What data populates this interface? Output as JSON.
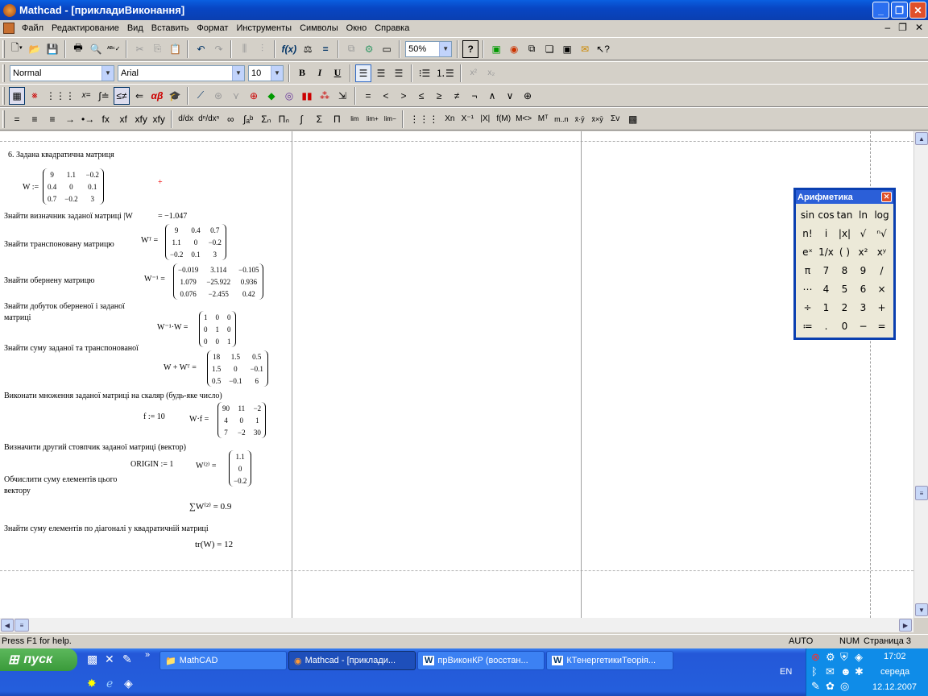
{
  "window": {
    "title": "Mathcad - [прикладиВиконання]"
  },
  "menu": [
    "Файл",
    "Редактирование",
    "Вид",
    "Вставить",
    "Формат",
    "Инструменты",
    "Символы",
    "Окно",
    "Справка"
  ],
  "toolbar": {
    "zoom": "50%"
  },
  "format_bar": {
    "style": "Normal",
    "font": "Arial",
    "size": "10",
    "bold": "B",
    "italic": "I",
    "underline": "U",
    "sup": "x²",
    "sub": "x₂"
  },
  "math_bar": {
    "alpha": "αβ"
  },
  "bool_bar": [
    "=",
    "<",
    ">",
    "≤",
    "≥",
    "≠",
    "¬",
    "∧",
    "∨",
    "⊕"
  ],
  "sym_bar": [
    "=",
    "≡",
    "≡",
    "→",
    "•→",
    "fx",
    "xf",
    "xfy",
    "xfy"
  ],
  "matrix_bar_labels": [
    "Xn",
    "X⁻¹",
    "|X|",
    "M<>",
    "Mᵀ",
    "m..n",
    "x̄·ȳ",
    "x̄×ȳ",
    "Σv"
  ],
  "worksheet": {
    "heading": "6. Задана квадратична матриця",
    "w_label": "W :=",
    "w": [
      [
        "9",
        "1.1",
        "−0.2"
      ],
      [
        "0.4",
        "0",
        "0.1"
      ],
      [
        "0.7",
        "−0.2",
        "3"
      ]
    ],
    "det_text": "Знайти визначник заданої матриці |W",
    "det_value": "= −1.047",
    "trans_text": "Знайти транспоновану матрицю",
    "wt_label": "Wᵀ =",
    "wt": [
      [
        "9",
        "0.4",
        "0.7"
      ],
      [
        "1.1",
        "0",
        "−0.2"
      ],
      [
        "−0.2",
        "0.1",
        "3"
      ]
    ],
    "inv_text": "Знайти обернену матрицю",
    "winv_label": "W⁻¹ =",
    "winv": [
      [
        "−0.019",
        "3.114",
        "−0.105"
      ],
      [
        "1.079",
        "−25.922",
        "0.936"
      ],
      [
        "0.076",
        "−2.455",
        "0.42"
      ]
    ],
    "prod_text1": "Знайти добуток оберненої і заданої",
    "prod_text2": "матриці",
    "prod_label": "W⁻¹·W =",
    "prod": [
      [
        "1",
        "0",
        "0"
      ],
      [
        "0",
        "1",
        "0"
      ],
      [
        "0",
        "0",
        "1"
      ]
    ],
    "sum_text": "Знайти суму заданої та транспонованої",
    "sum_label": "W + Wᵀ =",
    "sum": [
      [
        "18",
        "1.5",
        "0.5"
      ],
      [
        "1.5",
        "0",
        "−0.1"
      ],
      [
        "0.5",
        "−0.1",
        "6"
      ]
    ],
    "scal_text": "Виконати множення заданої матриці на скаляр (будь-яке число)",
    "f_def": "f := 10",
    "wf_label": "W·f =",
    "wf": [
      [
        "90",
        "11",
        "−2"
      ],
      [
        "4",
        "0",
        "1"
      ],
      [
        "7",
        "−2",
        "30"
      ]
    ],
    "col_text": "Визначити другий стовпчик заданої матриці (вектор)",
    "origin": "ORIGIN := 1",
    "col_label": "W⁽²⁾ =",
    "col": [
      [
        "1.1"
      ],
      [
        "0"
      ],
      [
        "−0.2"
      ]
    ],
    "sumel_text1": "Обчислити суму елементів цього",
    "sumel_text2": "вектору",
    "sumel_expr": "∑W⁽²⁾ = 0.9",
    "diag_text": "Знайти суму елементів по діагоналі у квадратичній матриці",
    "tr_expr": "tr(W) = 12"
  },
  "palette": {
    "title": "Арифметика",
    "keys": [
      "sin",
      "cos",
      "tan",
      "ln",
      "log",
      "n!",
      "i",
      "|x|",
      "√",
      "ⁿ√",
      "eˣ",
      "1/x",
      "( )",
      "x²",
      "xʸ",
      "π",
      "7",
      "8",
      "9",
      "/",
      "⋯",
      "4",
      "5",
      "6",
      "×",
      "÷",
      "1",
      "2",
      "3",
      "+",
      "≔",
      ".",
      "0",
      "−",
      "="
    ]
  },
  "status": {
    "help": "Press F1 for help.",
    "mode": "AUTO",
    "num": "NUM",
    "page": "Страница 3"
  },
  "taskbar": {
    "start": "пуск",
    "tasks": [
      "MathCAD",
      "Mathcad - [приклади...",
      "прВиконКР (восстан...",
      "КТенергетикиТеорія..."
    ],
    "lang": "EN",
    "time": "17:02",
    "day": "середа",
    "date": "12.12.2007"
  }
}
